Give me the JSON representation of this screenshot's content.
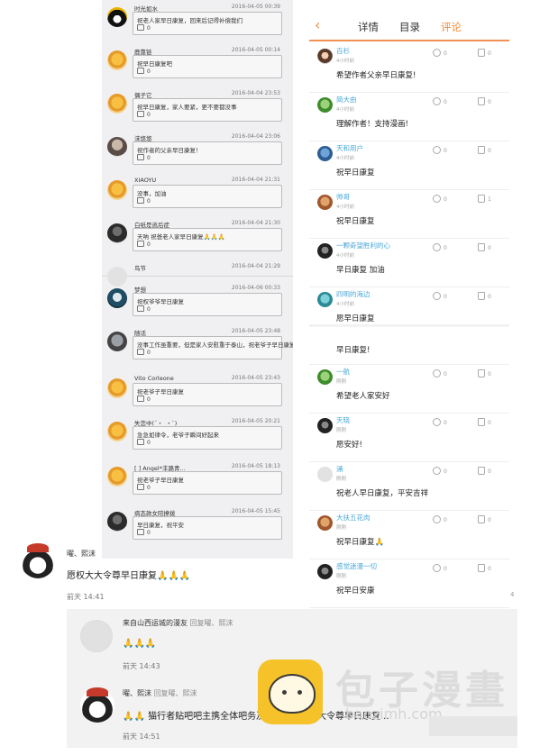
{
  "qq_comments": [
    {
      "user": "时光如水",
      "date": "2016-04-05 00:39",
      "text": "祝老人家早日康复，回来后记得补偿我们",
      "replies": "0"
    },
    {
      "user": "鹿靠链",
      "date": "2016-04-05 00:14",
      "text": "祝早日康复吧",
      "replies": "0"
    },
    {
      "user": "偶子它_",
      "date": "2016-04-04 23:53",
      "text": "祝早日康复，家人要紧，更不要都没事",
      "replies": "0"
    },
    {
      "user": "沫悠悠",
      "date": "2016-04-04 23:06",
      "text": "祝作者的父亲早日康复！",
      "replies": "0"
    },
    {
      "user": "XIAOYU",
      "date": "2016-04-04 21:31",
      "text": "没事，加油",
      "replies": "0"
    },
    {
      "user": "白纸是逃后症",
      "date": "2016-04-04 21:30",
      "text": "天呐 祝爸老人家早日康复🙏🙏🙏",
      "replies": "0"
    },
    {
      "user": "鸟节",
      "date": "2016-04-04 21:29",
      "text": "",
      "replies": ""
    },
    {
      "user": "梦想",
      "date": "2016-04-06 00:33",
      "text": "祝权爷爷早日康复",
      "replies": "0"
    },
    {
      "user": "随话",
      "date": "2016-04-05 23:48",
      "text": "没事工作虽重要，但是家人安慰重于泰山，祝老爷子早日康复",
      "replies": "0"
    },
    {
      "user": "Vito Corleone",
      "date": "2016-04-05 23:43",
      "text": "祝老爷子早日康复",
      "replies": "0"
    },
    {
      "user": "失恋中(´・_・`)",
      "date": "2016-04-05 20:21",
      "text": "急急如律令，老爷子瞬间好起来",
      "replies": "0"
    },
    {
      "user": "[ ] Angel*丰路青...",
      "date": "2016-04-05 18:13",
      "text": "祝老爷子早日康复",
      "replies": "0"
    },
    {
      "user": "病态款女陪撩拨",
      "date": "2016-04-05 15:45",
      "text": "早日康复，祝平安",
      "replies": "0"
    }
  ],
  "reader": {
    "tabs": [
      "详情",
      "目录",
      "评论"
    ],
    "back_icon": "‹",
    "page_number": "4",
    "comments": [
      {
        "user": "百杉",
        "time": "4小时前",
        "text": "希望作者父亲早日康复!",
        "replies": "0",
        "likes": "0"
      },
      {
        "user": "简大由",
        "time": "4小时前",
        "text": "理解作者！支持漫画!",
        "replies": "0",
        "likes": "0"
      },
      {
        "user": "天和用户",
        "time": "4小时前",
        "text": "祝早日康复",
        "replies": "0",
        "likes": "0"
      },
      {
        "user": "帅哥",
        "time": "4小时前",
        "text": "祝早日康复",
        "replies": "0",
        "likes": "1"
      },
      {
        "user": "一颗奇望胜利的心",
        "time": "4小时前",
        "text": "早日康复  加油",
        "replies": "0",
        "likes": "0"
      },
      {
        "user": "四明的海边",
        "time": "4小时前",
        "text": "愿早日康复",
        "replies": "0",
        "likes": "0"
      },
      {
        "user": "",
        "time": "",
        "text": "早日康复!",
        "replies": "",
        "likes": ""
      },
      {
        "user": "一航",
        "time": "刚刚",
        "text": "希望老人家安好",
        "replies": "0",
        "likes": "0"
      },
      {
        "user": "天晓",
        "time": "刚刚",
        "text": "愿安好!",
        "replies": "0",
        "likes": "0"
      },
      {
        "user": "涌",
        "time": "刚刚",
        "text": "祝老人早日康复，平安吉祥",
        "replies": "0",
        "likes": "0"
      },
      {
        "user": "大扶五花肉",
        "time": "刚刚",
        "text": "祝早日康复🙏",
        "replies": "0",
        "likes": "0"
      },
      {
        "user": "感觉迷漫一切",
        "time": "刚刚",
        "text": "祝早日安康",
        "replies": "0",
        "likes": "0"
      }
    ]
  },
  "weibo": {
    "c1": {
      "user": "曜、熙沫",
      "text": "愿权大大令尊早日康复🙏🙏🙏",
      "time": "前天 14:41"
    },
    "c2": {
      "user": "来自山西运城的漫友",
      "reply_label": "回复",
      "reply_to": "曜、熙沫",
      "text": "🙏🙏🙏",
      "time": "前天 14:43"
    },
    "c3": {
      "user": "曜、熙沫",
      "reply_label": "回复",
      "reply_to": "曜、熙沫",
      "text": "🙏🙏 猫行者贴吧吧主携全体吧务及",
      "text2": "大大令尊早日康复...",
      "time": "前天 14:51"
    }
  },
  "watermark": {
    "brand": "包子漫畫",
    "url": "baozimh.com"
  },
  "colors": {
    "accent": "#f18b3c",
    "username_blue": "#4aa8d8",
    "logo_yellow": "#f6c22a"
  }
}
